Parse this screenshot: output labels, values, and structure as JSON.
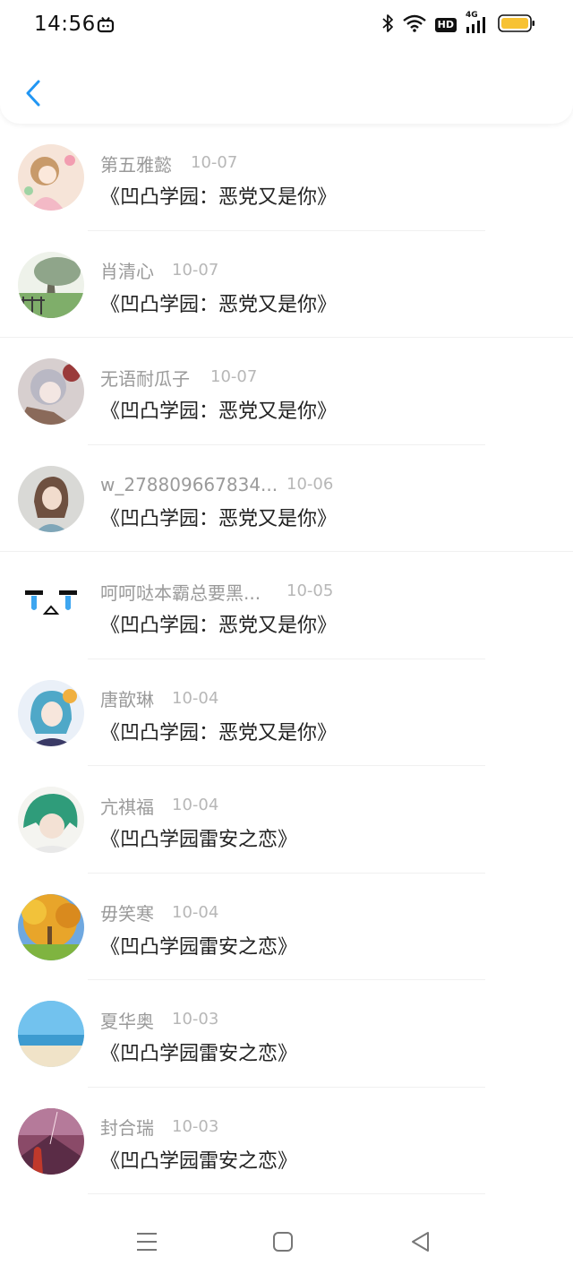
{
  "status_bar": {
    "time": "14:56",
    "hd_label": "HD",
    "network_label": "4G",
    "icons": [
      "bilibili-tv-icon",
      "bluetooth-icon",
      "wifi-icon",
      "signal-icon",
      "battery-icon"
    ],
    "battery_color": "#f7c233"
  },
  "header": {
    "back_icon": "chevron-left-icon",
    "accent_color": "#2196f3"
  },
  "list": {
    "items": [
      {
        "name": "第五雅懿",
        "date": "10-07",
        "title": "《凹凸学园：恶党又是你》",
        "avatar": "anime-girl-pink"
      },
      {
        "name": "肖清心",
        "date": "10-07",
        "title": "《凹凸学园：恶党又是你》",
        "avatar": "tree-landscape"
      },
      {
        "name": "无语耐瓜子",
        "date": "10-07",
        "title": "《凹凸学园：恶党又是你》",
        "avatar": "anime-grey-hair"
      },
      {
        "name": "w_278809667834...",
        "date": "10-06",
        "title": "《凹凸学园：恶党又是你》",
        "avatar": "anime-brown-hair"
      },
      {
        "name": "呵呵哒本霸总要黑...",
        "date": "10-05",
        "title": "《凹凸学园：恶党又是你》",
        "avatar": "crying-face"
      },
      {
        "name": "唐歆琳",
        "date": "10-04",
        "title": "《凹凸学园：恶党又是你》",
        "avatar": "anime-blue-hair"
      },
      {
        "name": "亢祺福",
        "date": "10-04",
        "title": "《凹凸学园雷安之恋》",
        "avatar": "anime-green-hair"
      },
      {
        "name": "毋笑寒",
        "date": "10-04",
        "title": "《凹凸学园雷安之恋》",
        "avatar": "autumn-tree"
      },
      {
        "name": "夏华奥",
        "date": "10-03",
        "title": "《凹凸学园雷安之恋》",
        "avatar": "beach-sky"
      },
      {
        "name": "封合瑞",
        "date": "10-03",
        "title": "《凹凸学园雷安之恋》",
        "avatar": "sunset-figure"
      }
    ]
  },
  "nav_bar": {
    "icons": [
      "menu-icon",
      "home-square-icon",
      "back-triangle-icon"
    ]
  }
}
